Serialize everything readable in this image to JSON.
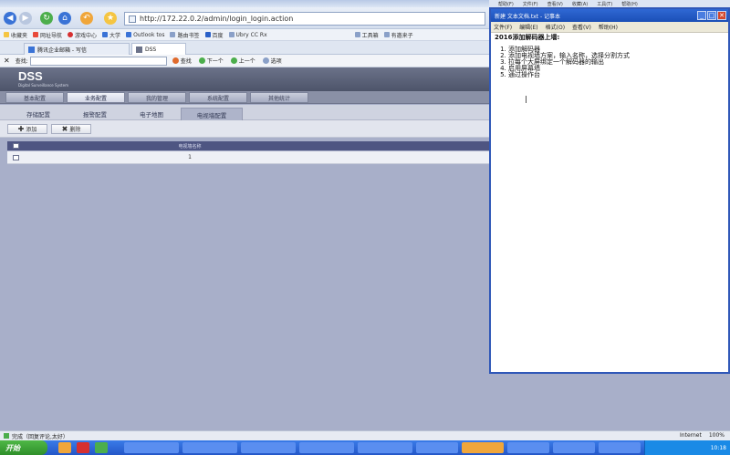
{
  "browser": {
    "menu_right": [
      "帮助(F)",
      "文件(F)",
      "查看(V)",
      "收藏(A)",
      "工具(T)",
      "帮助(H)"
    ],
    "address": "http://172.22.0.2/admin/login_login.action",
    "favorites": [
      "收藏夹",
      "网址导航",
      "游戏中心",
      "大学",
      "Outlook tos",
      "路由书签",
      "百度",
      "Ubry CC Rx",
      "工具箱",
      "有邀来子"
    ],
    "tabs": [
      "腾讯企业邮箱 - 写信",
      "DSS"
    ],
    "find": {
      "label": "查找:",
      "value": "",
      "find_btn": "查找",
      "next_btn": "下一个",
      "prev_btn": "上一个",
      "options_btn": "选项"
    }
  },
  "app": {
    "logo": "DSS",
    "subtitle": "Digital Surveillance System",
    "main_tabs": [
      "基本配置",
      "业务配置",
      "我的管理",
      "系统配置",
      "其他统计"
    ],
    "active_main_tab": 1,
    "sub_tabs": [
      "存储配置",
      "报警配置",
      "电子地图",
      "电视墙配置"
    ],
    "active_sub_tab": 3,
    "toolbar": {
      "add": "添加",
      "delete": "删除"
    },
    "grid": {
      "column_header": "电视墙名称",
      "rows": [
        {
          "name": "1"
        }
      ]
    }
  },
  "notepad": {
    "title": "新建 文本文档.txt - 记事本",
    "menu": [
      "文件(F)",
      "编辑(E)",
      "格式(O)",
      "查看(V)",
      "帮助(H)"
    ],
    "heading": "2016添加解码器上墙:",
    "steps": [
      "添加解码器",
      "添加电视墙方案，输入名称，选择分割方式",
      "拉每个大屏绑定一个解码器的输出",
      "启用屏幕墙",
      "通过操作台"
    ]
  },
  "statusbar": {
    "left": "完成（回复评论,太好）",
    "right": [
      "Internet",
      "100%"
    ]
  },
  "taskbar": {
    "start": "开始",
    "tray": "10:18"
  }
}
